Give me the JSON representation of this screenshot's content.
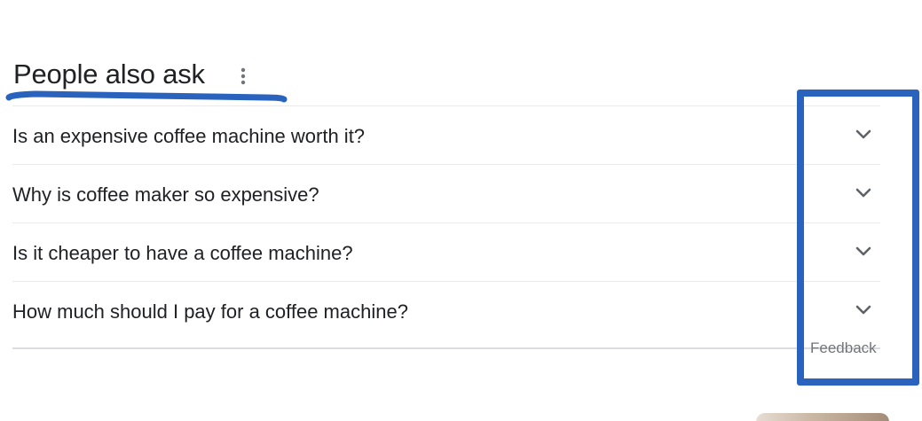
{
  "section": {
    "title": "People also ask",
    "more_icon": "more-vert-icon"
  },
  "questions": [
    {
      "text": "Is an expensive coffee machine worth it?",
      "icon": "chevron-down-icon"
    },
    {
      "text": "Why is coffee maker so expensive?",
      "icon": "chevron-down-icon"
    },
    {
      "text": "Is it cheaper to have a coffee machine?",
      "icon": "chevron-down-icon"
    },
    {
      "text": "How much should I pay for a coffee machine?",
      "icon": "chevron-down-icon"
    }
  ],
  "feedback_label": "Feedback",
  "annotation": {
    "color": "#2a63be"
  }
}
